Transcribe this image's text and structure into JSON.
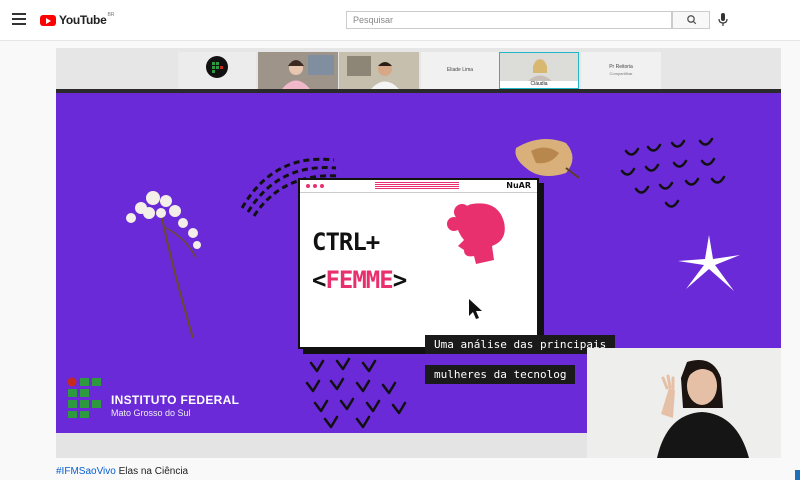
{
  "header": {
    "logo_text": "YouTube",
    "logo_country": "BR",
    "search_placeholder": "Pesquisar",
    "accent_color": "#ff0000"
  },
  "meet": {
    "participants": [
      {
        "name": "Eliade Lima"
      },
      {
        "name": "Cláudia"
      },
      {
        "name": "Pr Reitoria",
        "subtitle": "Compartilhar"
      }
    ]
  },
  "slide": {
    "background_color": "#6a2ad8",
    "accent_color": "#e9306f",
    "window_brand": "NuAR",
    "title_line1": "CTRL+",
    "title_line2_open": "<",
    "title_line2_word": "FEMME",
    "title_line2_close": ">",
    "caption_line1": "Uma análise das principais",
    "caption_line2": "mulheres da tecnolog",
    "institute_name": "INSTITUTO FEDERAL",
    "institute_sub": "Mato Grosso do Sul"
  },
  "video": {
    "hashtag": "#IFMSaoVivo",
    "title": "Elas na Ciência"
  }
}
